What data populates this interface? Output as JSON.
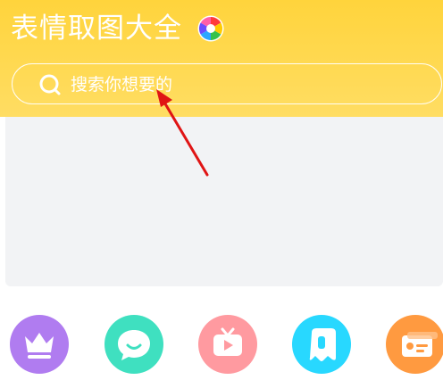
{
  "header": {
    "title": "表情取图大全",
    "logo_icon": "pinwheel-logo-icon",
    "background_color": "#ffd43c"
  },
  "search": {
    "placeholder": "搜索你想要的",
    "icon": "search-icon"
  },
  "banner": {
    "background_color": "#f2f3f5"
  },
  "annotation": {
    "type": "red-arrow",
    "color": "#e01414"
  },
  "categories": [
    {
      "icon": "crown-icon",
      "color": "#b07cf0"
    },
    {
      "icon": "chat-bubble-icon",
      "color": "#3fe0c0"
    },
    {
      "icon": "video-tv-icon",
      "color": "#ff9aa0"
    },
    {
      "icon": "sticker-icon",
      "color": "#28d8ff"
    },
    {
      "icon": "card-icon",
      "color": "#ff9a40"
    }
  ]
}
